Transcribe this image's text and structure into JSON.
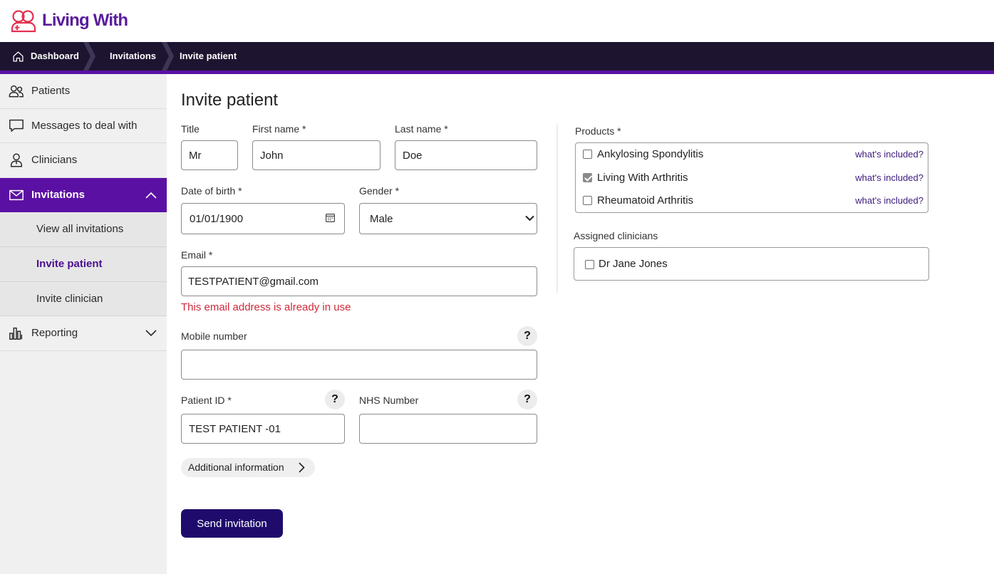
{
  "app": {
    "logo_text": "Living With",
    "logo_icon": "living-with-logo-icon"
  },
  "breadcrumb": {
    "home_icon": "home-icon",
    "items": [
      {
        "label": "Dashboard"
      },
      {
        "label": "Invitations"
      },
      {
        "label": "Invite patient"
      }
    ]
  },
  "sidebar": {
    "items": [
      {
        "label": "Patients",
        "icon": "patients-icon",
        "active": false
      },
      {
        "label": "Messages to deal with",
        "icon": "message-icon",
        "active": false
      },
      {
        "label": "Clinicians",
        "icon": "clinician-icon",
        "active": false
      },
      {
        "label": "Invitations",
        "icon": "envelope-icon",
        "active": true,
        "toggle_icon": "chevron-up-icon"
      },
      {
        "label": "Reporting",
        "icon": "bar-chart-icon",
        "active": false,
        "toggle_icon": "chevron-down-icon"
      }
    ],
    "invitations_subitems": [
      {
        "label": "View all invitations",
        "active": false
      },
      {
        "label": "Invite patient",
        "active": true
      },
      {
        "label": "Invite clinician",
        "active": false
      }
    ]
  },
  "form": {
    "heading": "Invite patient",
    "title": {
      "label": "Title",
      "value": "Mr"
    },
    "first_name": {
      "label": "First name *",
      "value": "John"
    },
    "last_name": {
      "label": "Last name *",
      "value": "Doe"
    },
    "date_of_birth": {
      "label": "Date of birth *",
      "value": "01/01/1900",
      "icon": "calendar-icon"
    },
    "gender": {
      "label": "Gender *",
      "value": "Male",
      "icon": "chevron-down-icon"
    },
    "email": {
      "label": "Email *",
      "value": "TESTPATIENT@gmail.com",
      "error": "This email address is already in use"
    },
    "mobile": {
      "label": "Mobile number",
      "value": "",
      "help": "?"
    },
    "patient_id": {
      "label": "Patient ID *",
      "value": "TEST PATIENT -01",
      "help": "?"
    },
    "nhs_number": {
      "label": "NHS Number",
      "value": "",
      "help": "?"
    },
    "additional_info": {
      "label": "Additional information",
      "icon": "chevron-right-icon"
    },
    "submit": {
      "label": "Send invitation"
    }
  },
  "products": {
    "label": "Products *",
    "items": [
      {
        "name": "Ankylosing Spondylitis",
        "checked": false,
        "link": "what's included?"
      },
      {
        "name": "Living With Arthritis",
        "checked": true,
        "link": "what's included?"
      },
      {
        "name": "Rheumatoid Arthritis",
        "checked": false,
        "link": "what's included?"
      }
    ]
  },
  "assigned_clinicians": {
    "label": "Assigned clinicians",
    "items": [
      {
        "name": "Dr Jane Jones",
        "checked": false
      }
    ]
  },
  "colors": {
    "brand": "#5a1d9b",
    "logo": "#e4304f",
    "nav_bg": "#1d1530",
    "accent": "#5b10a4",
    "error": "#d0293a",
    "button": "#1f0b6c",
    "link": "#3c1a7c"
  }
}
